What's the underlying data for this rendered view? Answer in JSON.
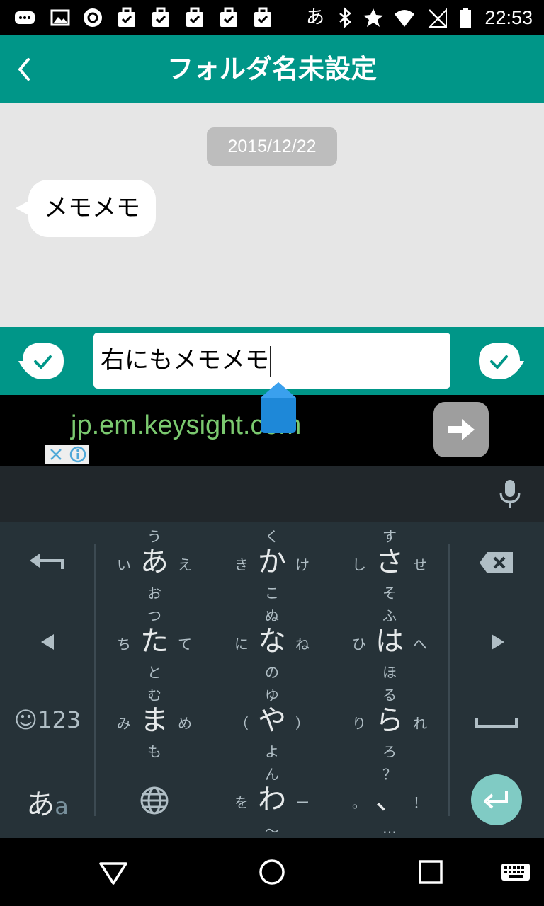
{
  "status_bar": {
    "ime_indicator": "あ",
    "time": "22:53",
    "icons": [
      "chat-icon",
      "image-icon",
      "app-icon",
      "task-icon",
      "task-icon",
      "task-icon",
      "task-icon",
      "task-icon",
      "bluetooth-icon",
      "star-icon",
      "wifi-icon",
      "no-sim-icon",
      "battery-icon"
    ]
  },
  "app_bar": {
    "title": "フォルダ名未設定",
    "back_icon": "chevron-left-icon"
  },
  "chat": {
    "date": "2015/12/22",
    "messages": [
      {
        "text": "メモメモ"
      }
    ]
  },
  "input": {
    "value": "右にもメモメモ"
  },
  "ad": {
    "url_text": "jp.em.keysight.com"
  },
  "keyboard": {
    "keys": [
      {
        "main": "あ",
        "up": "う",
        "down": "お",
        "left": "い",
        "right": "え"
      },
      {
        "main": "か",
        "up": "く",
        "down": "こ",
        "left": "き",
        "right": "け"
      },
      {
        "main": "さ",
        "up": "す",
        "down": "そ",
        "left": "し",
        "right": "せ"
      },
      {
        "main": "た",
        "up": "つ",
        "down": "と",
        "left": "ち",
        "right": "て"
      },
      {
        "main": "な",
        "up": "ぬ",
        "down": "の",
        "left": "に",
        "right": "ね"
      },
      {
        "main": "は",
        "up": "ふ",
        "down": "ほ",
        "left": "ひ",
        "right": "へ"
      },
      {
        "main": "ま",
        "up": "む",
        "down": "も",
        "left": "み",
        "right": "め"
      },
      {
        "main": "や",
        "up": "ゆ",
        "down": "よ",
        "left": "（",
        "right": "）"
      },
      {
        "main": "ら",
        "up": "る",
        "down": "ろ",
        "left": "り",
        "right": "れ"
      },
      {
        "main": "わ",
        "up": "ん",
        "down": "～",
        "left": "を",
        "right": "ー"
      },
      {
        "main": "、",
        "up": "？",
        "down": "…",
        "left": "。",
        "right": "！"
      }
    ],
    "emoji_key": "☺123",
    "mode_key_main": "あ",
    "mode_key_sub": "a"
  },
  "colors": {
    "accent": "#009688",
    "chat_bg": "#e6e6e6",
    "keyboard_bg": "#263238",
    "enter": "#80cbc4",
    "ad_text": "#7bc96f"
  }
}
